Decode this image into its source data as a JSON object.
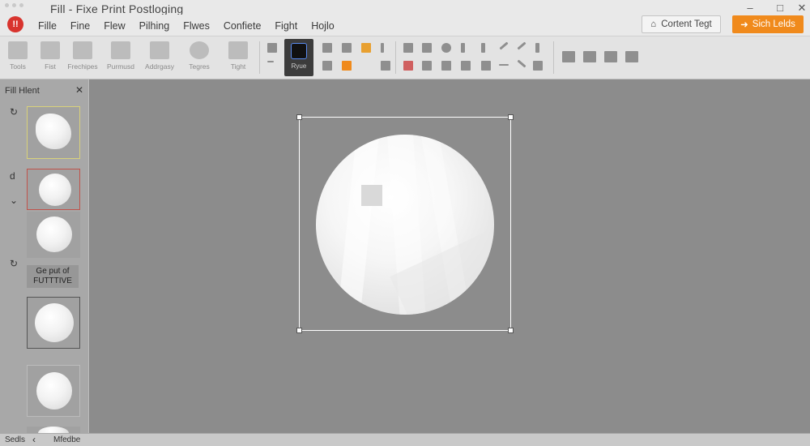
{
  "window": {
    "title": "Fill - Fixe Print Postloging",
    "controls": [
      "–",
      "□",
      "✕"
    ]
  },
  "menu": {
    "badge": "!!",
    "items": [
      "Fille",
      "Fine",
      "Flew",
      "Pilhing",
      "Flwes",
      "Confiete",
      "Fight",
      "Hojlo"
    ],
    "content_button": "Cortent Tegt",
    "action_button": "Sich Lelds"
  },
  "toolbar": {
    "tools": [
      {
        "label": "Tools",
        "icon": "pencil-icon"
      },
      {
        "label": "Fist",
        "icon": "document-icon"
      },
      {
        "label": "Frechipes",
        "icon": "window-icon"
      },
      {
        "label": "Purmusd",
        "icon": "triangle-icon"
      },
      {
        "label": "Addrgasy",
        "icon": "paint-icon"
      },
      {
        "label": "Tegres",
        "icon": "globe-icon"
      },
      {
        "label": "Tight",
        "icon": "stamp-icon"
      }
    ],
    "active_tool_label": "Ryue"
  },
  "panel": {
    "title": "Fill  Hlent",
    "close": "✕",
    "side_icons": [
      "↻",
      "d",
      "⌄",
      "↻"
    ],
    "caption_line1": "Ge put of",
    "caption_line2": "FUTTTIVE"
  },
  "status": {
    "left": "Sedls",
    "arrow": "‹",
    "mode": "Mfedbe"
  },
  "colors": {
    "accent": "#f08a1c",
    "badge": "#d8342e",
    "canvas": "#8c8c8c"
  }
}
